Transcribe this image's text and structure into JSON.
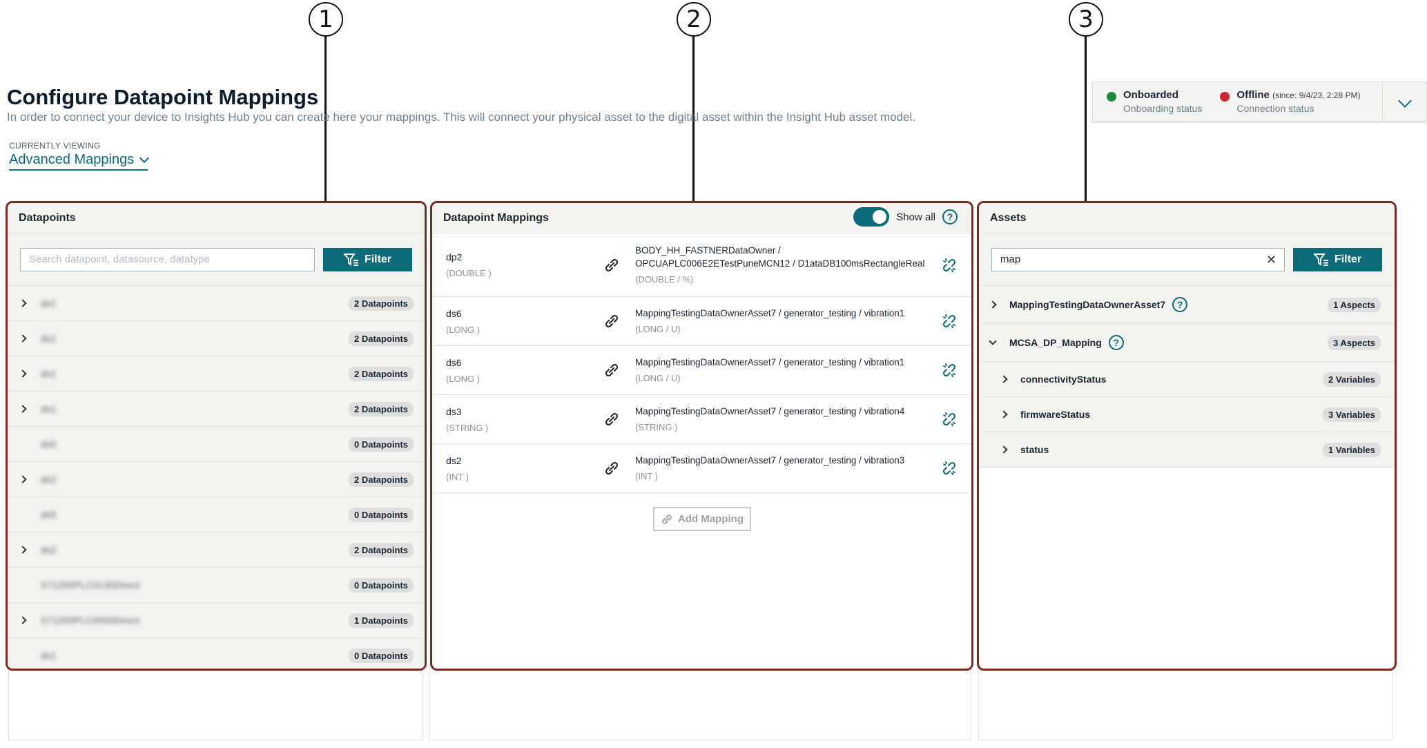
{
  "callouts": [
    "1",
    "2",
    "3"
  ],
  "header": {
    "title": "Configure Datapoint Mappings",
    "description": "In order to connect your device to Insights Hub you can create here your mappings. This will connect your physical asset to the digital asset within the Insight Hub asset model.",
    "viewing_label": "CURRENTLY VIEWING",
    "viewing_value": "Advanced Mappings"
  },
  "status": {
    "onboard_title": "Onboarded",
    "onboard_sub": "Onboarding status",
    "onboard_color": "#1a8a3c",
    "conn_title": "Offline",
    "conn_since": "(since: 9/4/23, 2:28 PM)",
    "conn_sub": "Connection status",
    "conn_color": "#d1252f"
  },
  "datapoints": {
    "title": "Datapoints",
    "search_placeholder": "Search datapoint, datasource, datatype",
    "filter_label": "Filter",
    "rows": [
      {
        "name": "ds1",
        "badge": "2 Datapoints",
        "expandable": true
      },
      {
        "name": "ds1",
        "badge": "2 Datapoints",
        "expandable": true
      },
      {
        "name": "ds1",
        "badge": "2 Datapoints",
        "expandable": true
      },
      {
        "name": "ds1",
        "badge": "2 Datapoints",
        "expandable": true
      },
      {
        "name": "ds5",
        "badge": "0 Datapoints",
        "expandable": false
      },
      {
        "name": "ds2",
        "badge": "2 Datapoints",
        "expandable": true
      },
      {
        "name": "ds5",
        "badge": "0 Datapoints",
        "expandable": false
      },
      {
        "name": "ds2",
        "badge": "2 Datapoints",
        "expandable": true
      },
      {
        "name": "S71200PLC0130Direct",
        "badge": "0 Datapoints",
        "expandable": false
      },
      {
        "name": "S71200PLC0050Direct",
        "badge": "1 Datapoints",
        "expandable": true
      },
      {
        "name": "ds1",
        "badge": "0 Datapoints",
        "expandable": false
      }
    ]
  },
  "mappings": {
    "title": "Datapoint Mappings",
    "show_all_label": "Show all",
    "add_label": "Add Mapping",
    "rows": [
      {
        "src": "dp2",
        "src_type": "(DOUBLE )",
        "tgt": "BODY_HH_FASTNERDataOwner / OPCUAPLC006E2ETestPuneMCN12 / D1ataDB100msRectangleReal",
        "tgt_type": "(DOUBLE / %)"
      },
      {
        "src": "ds6",
        "src_type": "(LONG )",
        "tgt": "MappingTestingDataOwnerAsset7 / generator_testing / vibration1",
        "tgt_type": "(LONG / U)"
      },
      {
        "src": "ds6",
        "src_type": "(LONG )",
        "tgt": "MappingTestingDataOwnerAsset7 / generator_testing / vibration1",
        "tgt_type": "(LONG / U)"
      },
      {
        "src": "ds3",
        "src_type": "(STRING )",
        "tgt": "MappingTestingDataOwnerAsset7 / generator_testing / vibration4",
        "tgt_type": "(STRING )"
      },
      {
        "src": "ds2",
        "src_type": "(INT )",
        "tgt": "MappingTestingDataOwnerAsset7 / generator_testing / vibration3",
        "tgt_type": "(INT )"
      }
    ]
  },
  "assets": {
    "title": "Assets",
    "search_value": "map",
    "filter_label": "Filter",
    "rows": [
      {
        "name": "MappingTestingDataOwnerAsset7",
        "badge": "1 Aspects",
        "help": true,
        "level": 0,
        "expanded": false
      },
      {
        "name": "MCSA_DP_Mapping",
        "badge": "3 Aspects",
        "help": true,
        "level": 0,
        "expanded": true
      },
      {
        "name": "connectivityStatus",
        "badge": "2 Variables",
        "help": false,
        "level": 1,
        "expanded": false
      },
      {
        "name": "firmwareStatus",
        "badge": "3 Variables",
        "help": false,
        "level": 1,
        "expanded": false
      },
      {
        "name": "status",
        "badge": "1 Variables",
        "help": false,
        "level": 1,
        "expanded": false
      }
    ]
  }
}
